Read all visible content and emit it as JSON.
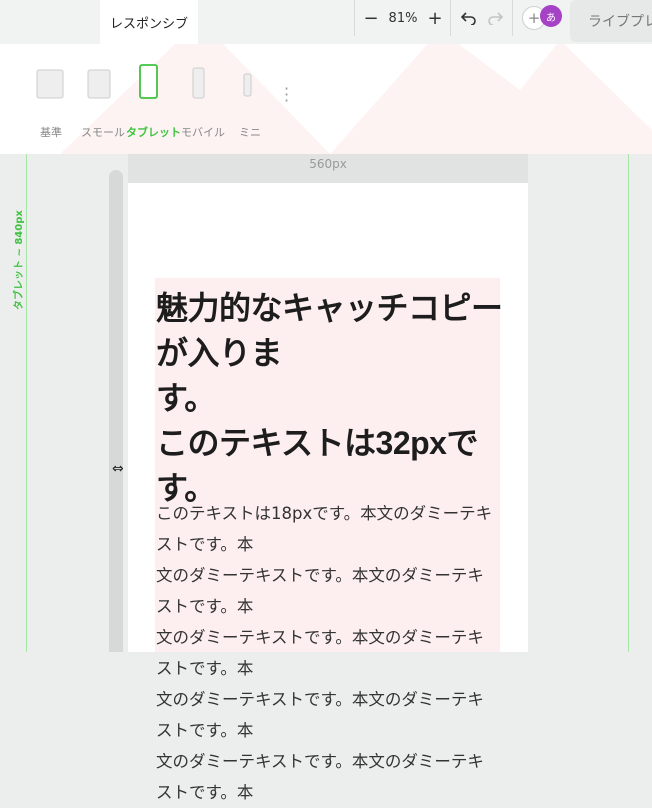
{
  "header": {
    "active_tab": "レスポンシブ",
    "zoom_minus": "−",
    "zoom_value": "81%",
    "zoom_plus": "+",
    "undo_icon": "undo-icon",
    "redo_icon": "redo-icon",
    "add_icon": "plus-icon",
    "avatar_text": "あ",
    "live_preview_tab": "ライブプレビ"
  },
  "devices": [
    {
      "label": "基準"
    },
    {
      "label": "スモール"
    },
    {
      "label": "タブレット",
      "active": true
    },
    {
      "label": "モバイル"
    },
    {
      "label": "ミニ"
    }
  ],
  "more_icon": "⋮",
  "canvas": {
    "breakpoint_label": "タブレット ~ 840px",
    "width_label": "560px",
    "resize_handle_icon": "⇔"
  },
  "content": {
    "headline_line1": "魅力的なキャッチコピーが入りま",
    "headline_line2": "す。",
    "headline_line3": "このテキストは32pxです。",
    "body_lines": [
      "このテキストは18pxです。本文のダミーテキストです。本",
      "文のダミーテキストです。本文のダミーテキストです。本",
      "文のダミーテキストです。本文のダミーテキストです。本",
      "文のダミーテキストです。本文のダミーテキストです。本",
      "文のダミーテキストです。本文のダミーテキストです。本"
    ]
  },
  "colors": {
    "accent_green": "#3fc33f",
    "avatar_purple": "#a542c6",
    "content_pink": "#fdeff0"
  }
}
